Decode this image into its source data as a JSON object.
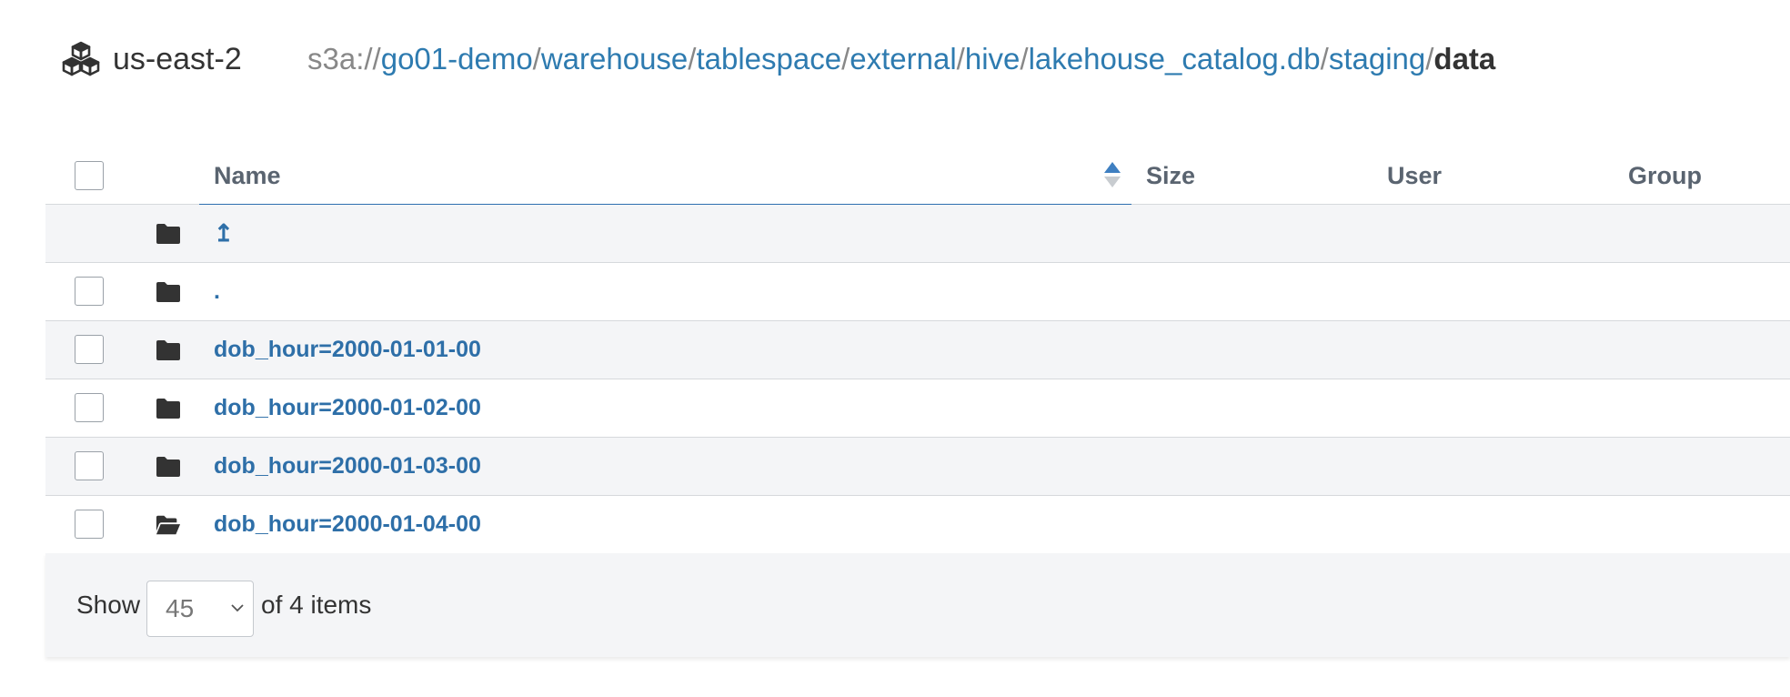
{
  "header": {
    "region": "us-east-2",
    "path": {
      "scheme": "s3a://",
      "segments": [
        "go01-demo",
        "warehouse",
        "tablespace",
        "external",
        "hive",
        "lakehouse_catalog.db",
        "staging"
      ],
      "separator": "/",
      "current": "data"
    }
  },
  "table": {
    "columns": {
      "name": "Name",
      "size": "Size",
      "user": "User",
      "group": "Group"
    },
    "sort": {
      "column": "Name",
      "direction": "ascending"
    },
    "rows": [
      {
        "name": "↥",
        "type": "parent",
        "icon": "folder-icon"
      },
      {
        "name": ".",
        "type": "current",
        "icon": "folder-icon"
      },
      {
        "name": "dob_hour=2000-01-01-00",
        "type": "folder",
        "icon": "folder-icon"
      },
      {
        "name": "dob_hour=2000-01-02-00",
        "type": "folder",
        "icon": "folder-icon"
      },
      {
        "name": "dob_hour=2000-01-03-00",
        "type": "folder",
        "icon": "folder-icon"
      },
      {
        "name": "dob_hour=2000-01-04-00",
        "type": "folder",
        "icon": "folder-open-icon"
      }
    ]
  },
  "footer": {
    "show_label": "Show",
    "page_size": "45",
    "items_label": "of 4 items"
  },
  "colors": {
    "link": "#2e6fa8",
    "path_link": "#2e7bb0",
    "row_alt": "#f4f5f7",
    "header_text": "#5a6470"
  }
}
